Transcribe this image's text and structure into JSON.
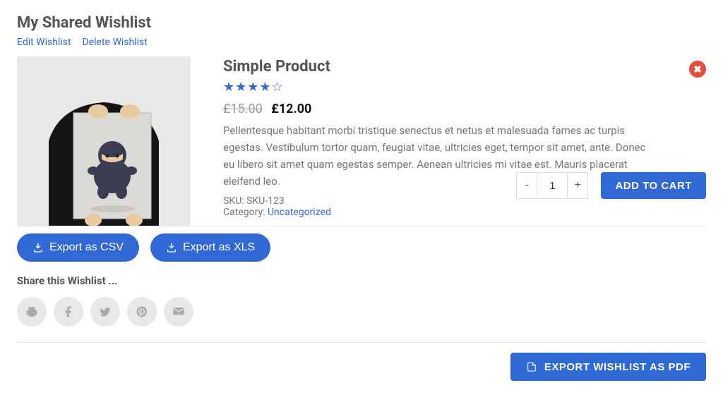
{
  "header": {
    "title": "My Shared Wishlist",
    "edit_label": "Edit Wishlist",
    "delete_label": "Delete Wishlist"
  },
  "product": {
    "title": "Simple Product",
    "rating_stars": "★★★★☆",
    "old_price": "£15.00",
    "new_price": "£12.00",
    "description": "Pellentesque habitant morbi tristique senectus et netus et malesuada fames ac turpis egestas. Vestibulum tortor quam, feugiat vitae, ultricies eget, tempor sit amet, ante. Donec eu libero sit amet quam egestas semper. Aenean ultricies mi vitae est. Mauris placerat eleifend leo.",
    "sku_label": "SKU:",
    "sku_value": "SKU-123",
    "category_label": "Category:",
    "category_value": "Uncategorized",
    "qty_value": "1",
    "add_to_cart_label": "ADD TO CART"
  },
  "export": {
    "csv_label": "Export as CSV",
    "xls_label": "Export as XLS"
  },
  "share": {
    "heading": "Share this Wishlist ..."
  },
  "pdf": {
    "label": "EXPORT WISHLIST AS PDF"
  }
}
